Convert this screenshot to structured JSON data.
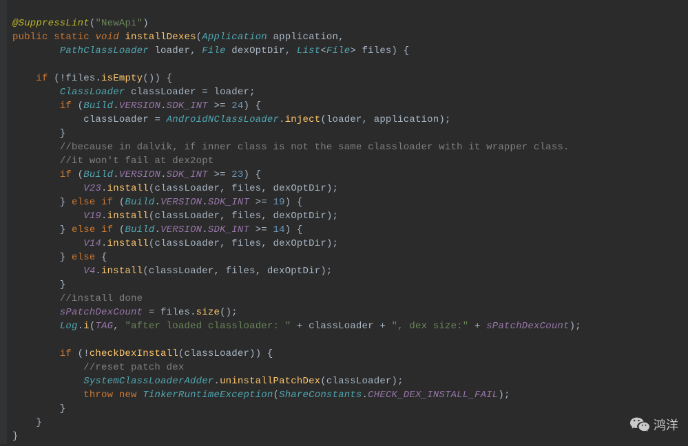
{
  "code": {
    "annotation": "@SuppressLint",
    "annotation_arg": "\"NewApi\"",
    "kw_public": "public",
    "kw_static": "static",
    "kw_void": "void",
    "fn_installDexes": "installDexes",
    "t_Application": "Application",
    "p_application": "application",
    "t_PathClassLoader": "PathClassLoader",
    "p_loader": "loader",
    "t_File": "File",
    "p_dexOptDir": "dexOptDir",
    "t_List": "List",
    "p_files": "files",
    "kw_if": "if",
    "kw_else": "else",
    "m_isEmpty": "isEmpty",
    "t_ClassLoader": "ClassLoader",
    "v_classLoader": "classLoader",
    "t_Build": "Build",
    "c_VERSION": "VERSION",
    "c_SDK_INT": "SDK_INT",
    "n24": "24",
    "n23": "23",
    "n19": "19",
    "n14": "14",
    "t_AndroidNClassLoader": "AndroidNClassLoader",
    "m_inject": "inject",
    "cmt1": "//because in dalvik, if inner class is not the same classloader with it wrapper class.",
    "cmt2": "//it won't fail at dex2opt",
    "c_V23": "V23",
    "c_V19": "V19",
    "c_V14": "V14",
    "c_V4": "V4",
    "m_install": "install",
    "cmt_done": "//install done",
    "v_sPatchDexCount": "sPatchDexCount",
    "m_size": "size",
    "t_Log": "Log",
    "m_i": "i",
    "c_TAG": "TAG",
    "s_after": "\"after loaded classloader: \"",
    "s_dexsize": "\", dex size:\"",
    "m_checkDexInstall": "checkDexInstall",
    "cmt_reset": "//reset patch dex",
    "t_SystemClassLoaderAdder": "SystemClassLoaderAdder",
    "m_uninstallPatchDex": "uninstallPatchDex",
    "kw_throw": "throw",
    "kw_new": "new",
    "t_TinkerRuntimeException": "TinkerRuntimeException",
    "t_ShareConstants": "ShareConstants",
    "c_CHECK": "CHECK_DEX_INSTALL_FAIL"
  },
  "watermark": "鸿洋"
}
